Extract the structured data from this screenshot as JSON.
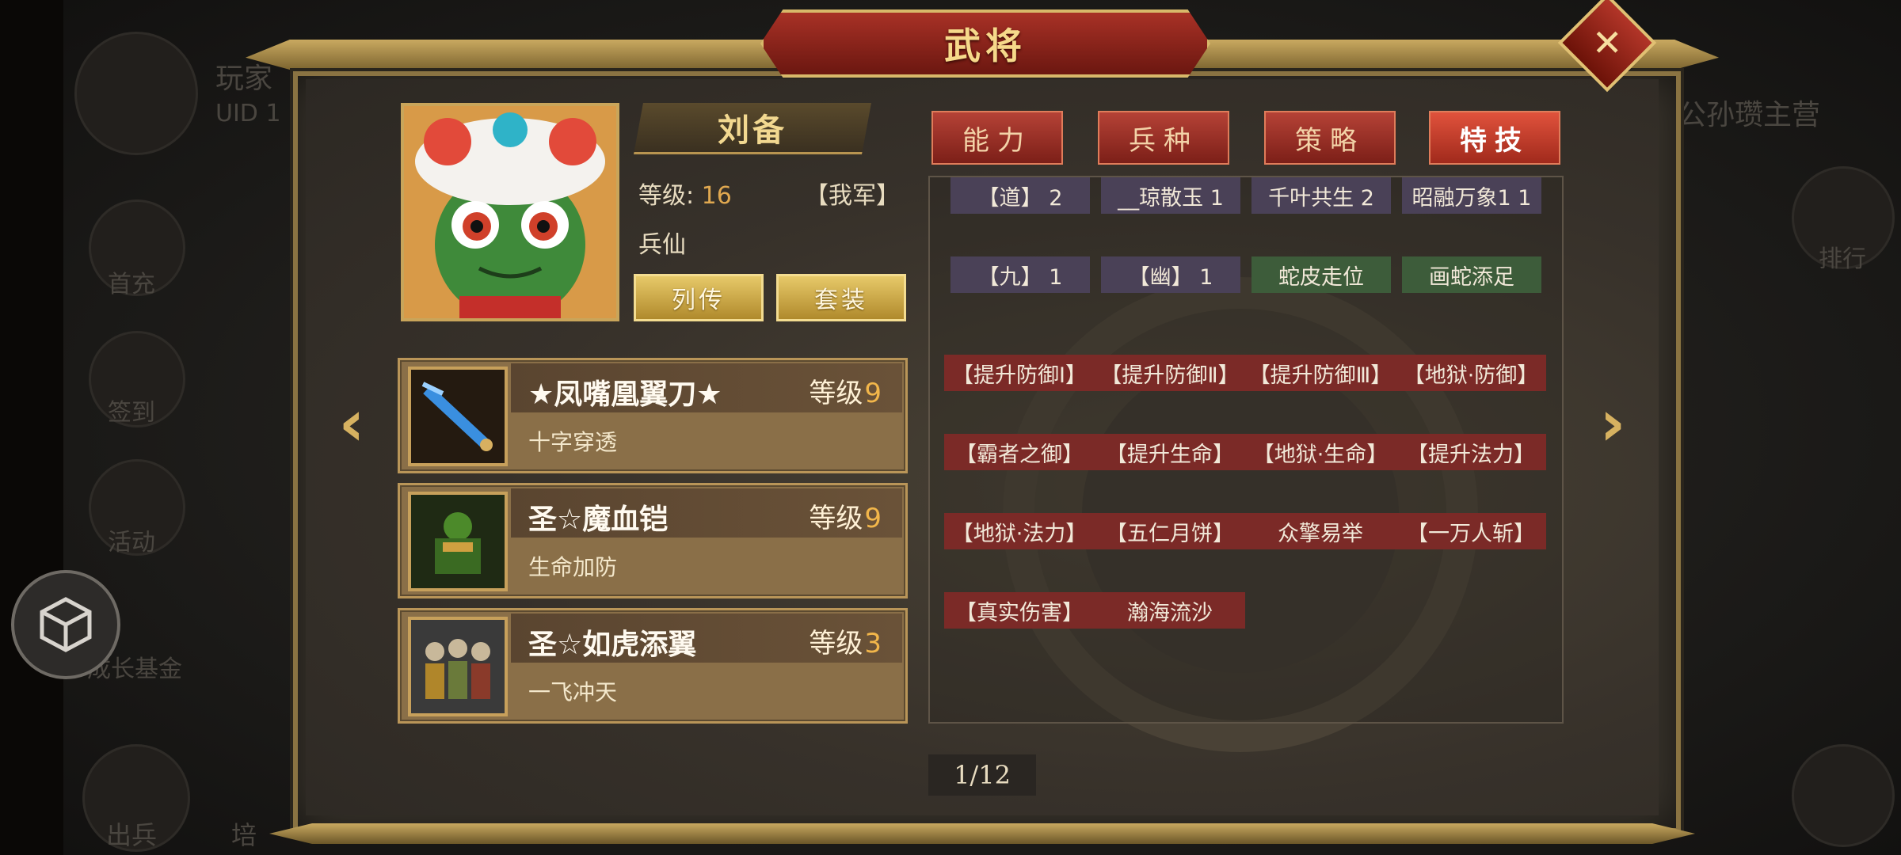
{
  "background": {
    "player_name": "玩家",
    "uid_label": "UID 1",
    "camp_label": "公孙瓒主营",
    "left_menu": [
      "首充",
      "签到",
      "活动",
      "成长基金",
      "出兵",
      "培"
    ],
    "right_menu": [
      "排行"
    ]
  },
  "window": {
    "title": "武将",
    "close_label": "✕"
  },
  "hero": {
    "name": "刘备",
    "level_label": "等级:",
    "level_value": "16",
    "faction": "【我军】",
    "type": "兵仙",
    "bio_button": "列传",
    "set_button": "套装"
  },
  "equipment": [
    {
      "name": "★凤嘴凰翼刀★",
      "level_label": "等级",
      "level": "9",
      "skill": "十字穿透",
      "icon": "weapon-blade-icon"
    },
    {
      "name": "圣☆魔血铠",
      "level_label": "等级",
      "level": "9",
      "skill": "生命加防",
      "icon": "armor-icon"
    },
    {
      "name": "圣☆如虎添翼",
      "level_label": "等级",
      "level": "3",
      "skill": "一飞冲天",
      "icon": "soldiers-icon"
    }
  ],
  "tabs": [
    "能力",
    "兵种",
    "策略",
    "特技"
  ],
  "active_tab": "特技",
  "skills": {
    "row1": [
      "【道】 2",
      "__琼散玉 1",
      "千叶共生 2",
      "昭融万象1 1"
    ],
    "row2": [
      "【九】 1",
      "【幽】 1",
      "蛇皮走位",
      "画蛇添足"
    ],
    "row3": [
      "【提升防御Ⅰ】",
      "【提升防御Ⅱ】",
      "【提升防御Ⅲ】",
      "【地狱·防御】"
    ],
    "row4": [
      "【霸者之御】",
      "【提升生命】",
      "【地狱·生命】",
      "【提升法力】"
    ],
    "row5": [
      "【地狱·法力】",
      "【五仁月饼】",
      "众擎易举",
      "【一万人斩】"
    ],
    "row6": [
      "【真实伤害】",
      "瀚海流沙"
    ]
  },
  "pagination": "1/12",
  "colors": {
    "accent_red": "#a83126",
    "gold": "#d8b86a",
    "chip_purple": "#4a4157",
    "chip_green": "#3d5c3a",
    "chip_red": "#7b2a27"
  }
}
